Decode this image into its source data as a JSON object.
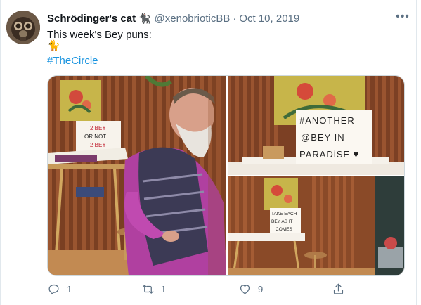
{
  "tweet": {
    "display_name": "Schrödinger's cat",
    "name_emoji": "🐈‍⬛",
    "handle": "@xenobrioticBB",
    "separator": "·",
    "date": "Oct 10, 2019",
    "text": "This week's Bey puns:",
    "emoji": "🐈",
    "hashtag": "#TheCircle",
    "more_label": "•••"
  },
  "media": {
    "images": [
      {
        "alt": "Man in purple shirt and striped vest at a desk with a lightbox sign",
        "sign_lines": [
          "2 BEY",
          "OR NOT",
          "2 BEY"
        ]
      },
      {
        "alt": "Lightbox sign on a desk",
        "sign_lines": [
          "#ANOTHER",
          "@BEY IN",
          "PARADiSE ♥"
        ]
      },
      {
        "alt": "Small desk with a lightbox sign",
        "sign_lines": [
          "TAKE EACH",
          "BEY AS IT",
          "COMES"
        ]
      }
    ]
  },
  "actions": {
    "reply_count": "1",
    "retweet_count": "1",
    "like_count": "9"
  },
  "icons": [
    "reply-icon",
    "retweet-icon",
    "like-icon",
    "share-icon",
    "more-icon"
  ],
  "colors": {
    "link": "#1b95e0",
    "secondary": "#5b7083",
    "border": "#e1e8ed"
  }
}
